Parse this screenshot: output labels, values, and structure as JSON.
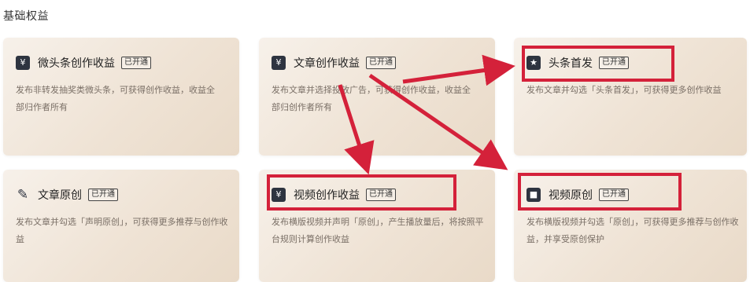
{
  "section_title": "基础权益",
  "cards": [
    {
      "title": "微头条创作收益",
      "badge": "已开通",
      "icon": "yen-icon",
      "desc": "发布非转发抽奖类微头条，可获得创作收益，收益全部归作者所有"
    },
    {
      "title": "文章创作收益",
      "badge": "已开通",
      "icon": "yen-icon",
      "desc": "发布文章并选择投放广告，可获得创作收益，收益全部归创作者所有"
    },
    {
      "title": "头条首发",
      "badge": "已开通",
      "icon": "star-icon",
      "desc": "发布文章并勾选「头条首发」，可获得更多创作收益"
    },
    {
      "title": "文章原创",
      "badge": "已开通",
      "icon": "pen-icon",
      "desc": "发布文章并勾选「声明原创」，可获得更多推荐与创作收益"
    },
    {
      "title": "视频创作收益",
      "badge": "已开通",
      "icon": "video-yen-icon",
      "desc": "发布横版视频并声明「原创」，产生播放量后，将按照平台规则计算创作收益"
    },
    {
      "title": "视频原创",
      "badge": "已开通",
      "icon": "video-camera-icon",
      "desc": "发布横版视频并勾选「原创」，可获得更多推荐与创作收益，并享受原创保护"
    }
  ],
  "colors": {
    "highlight": "#d4213a",
    "card": "#efe3d5",
    "icon": "#2e3440"
  }
}
